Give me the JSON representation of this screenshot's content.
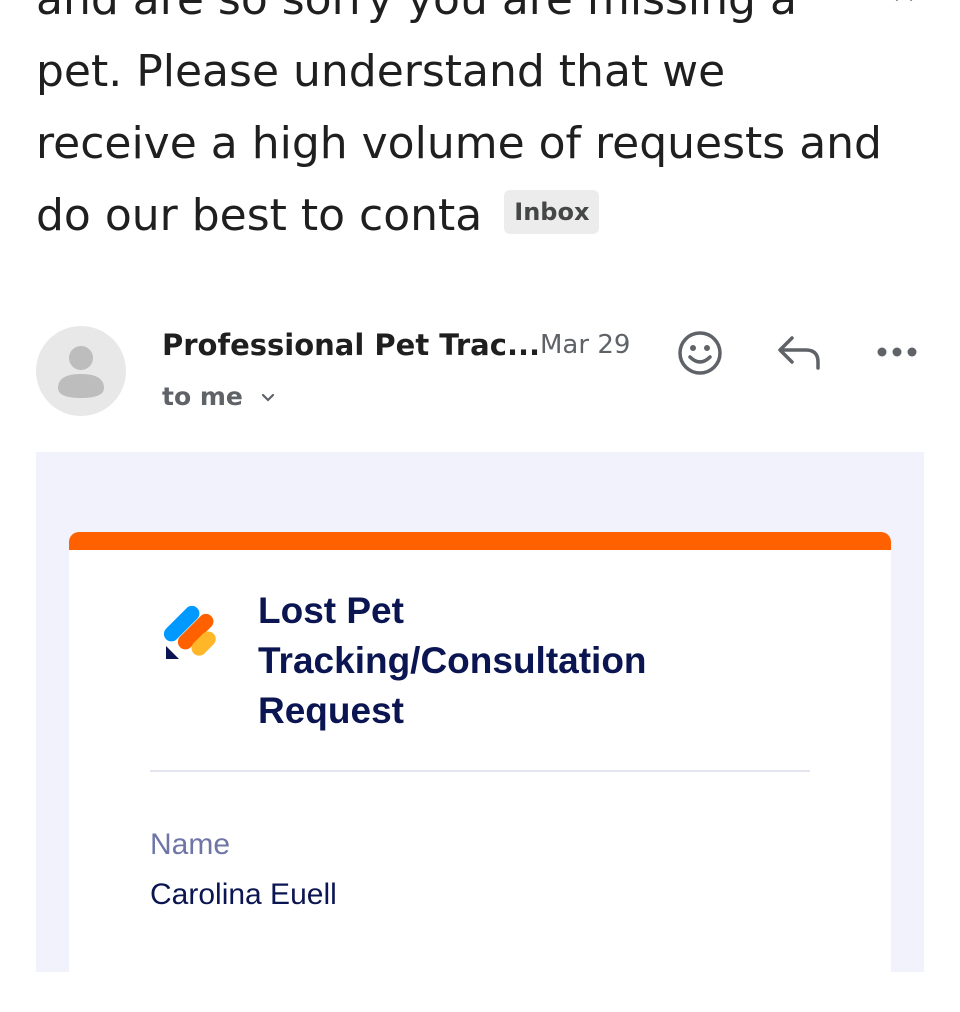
{
  "message": {
    "subject_preview": "and are so sorry you are missing a pet. Please understand that we receive a high volume of requests and do our best to conta",
    "label": "Inbox"
  },
  "header": {
    "sender": "Professional Pet Trac...",
    "date": "Mar 29",
    "recipient": "to me",
    "icons": [
      "person-avatar-icon",
      "emoji-smile-icon",
      "reply-icon",
      "more-options-icon",
      "chevron-down-icon"
    ]
  },
  "form": {
    "title": "Lost Pet Tracking/Consultation Request",
    "accent_color": "#ff6100",
    "title_color": "#0a1551",
    "fields": [
      {
        "label": "Name",
        "value": "Carolina Euell"
      }
    ]
  }
}
